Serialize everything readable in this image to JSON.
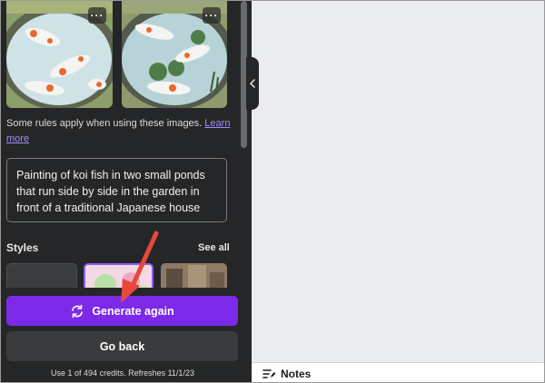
{
  "panel": {
    "rules_text": "Some rules apply when using these images.",
    "learn_more": "Learn more",
    "prompt": "Painting of koi fish in two small ponds that run side by side in the garden in front of a traditional Japanese house",
    "styles_label": "Styles",
    "see_all": "See all",
    "generate_label": "Generate again",
    "go_back_label": "Go back",
    "credits": "Use 1 of 494 credits. Refreshes 11/1/23",
    "more_glyph": "···"
  },
  "editor": {
    "notes_label": "Notes"
  },
  "colors": {
    "panel_bg": "#252627",
    "accent": "#7d2ae8",
    "link": "#a08bff",
    "canvas_bg": "#ebecf0",
    "annotation_arrow": "#e8473a"
  }
}
